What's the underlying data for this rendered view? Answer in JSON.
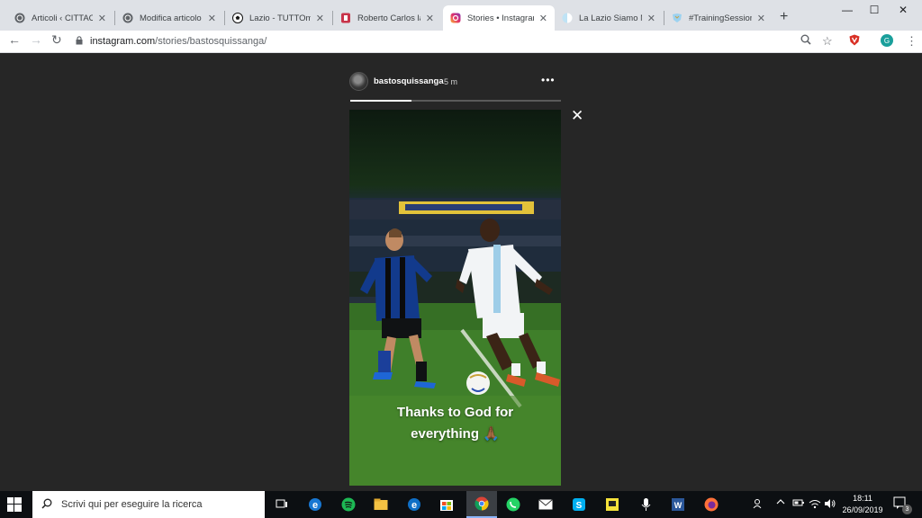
{
  "browser": {
    "tabs": [
      {
        "title": "Articoli ‹ CITTACEL",
        "icon": "wordpress-icon"
      },
      {
        "title": "Modifica articolo ‹",
        "icon": "wordpress-icon"
      },
      {
        "title": "Lazio - TUTTOmerc",
        "icon": "soccer-ball-icon"
      },
      {
        "title": "Roberto Carlos lan",
        "icon": "site-icon"
      },
      {
        "title": "Stories • Instagram",
        "icon": "instagram-icon",
        "active": true
      },
      {
        "title": "La Lazio Siamo No",
        "icon": "lazio-icon"
      },
      {
        "title": "#TrainingSession |",
        "icon": "lazio-crest-icon"
      }
    ],
    "new_tab": "+",
    "url_domain": "instagram.com",
    "url_path": "/stories/bastosquissanga/",
    "profile_initial": "G"
  },
  "story": {
    "username": "bastosquissanga",
    "time": "5 m",
    "more": "•••",
    "progress": 0.29,
    "caption_line1": "Thanks to God for",
    "caption_line2": "everything 🙏🏾"
  },
  "taskbar": {
    "search_placeholder": "Scrivi qui per eseguire la ricerca",
    "time": "18:11",
    "date": "26/09/2019",
    "notification_count": "3"
  }
}
